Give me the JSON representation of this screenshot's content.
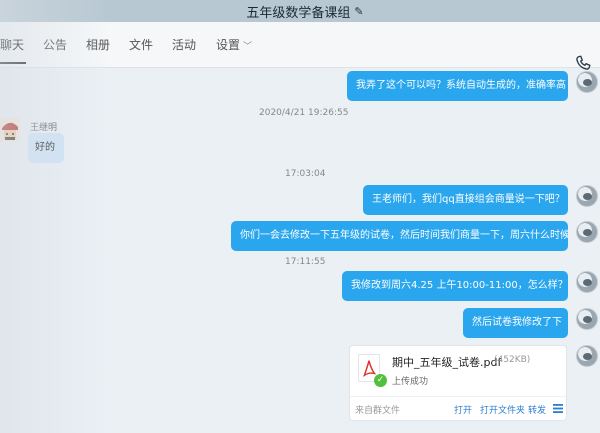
{
  "window": {
    "title": "五年级数学备课组"
  },
  "tabs": [
    {
      "label": "聊天",
      "active": true
    },
    {
      "label": "公告"
    },
    {
      "label": "相册"
    },
    {
      "label": "文件"
    },
    {
      "label": "活动"
    },
    {
      "label": "设置"
    }
  ],
  "messages": {
    "m1": "我弄了这个可以吗？系统自动生成的，准确率高",
    "t1": "2020/4/21 19:26:55",
    "sender": "王继明",
    "m2": "好的",
    "t2": "17:03:04",
    "m3": "王老师们，我们qq直接组会商量说一下吧？",
    "m4": "你们一会去修改一下五年级的试卷，然后时间我们商量一下，周六什么时候？",
    "t3": "17:11:55",
    "m5": "我修改到周六4.25 上午10:00-11:00，怎么样？",
    "m6": "然后试卷我修改了下"
  },
  "file": {
    "name": "期中_五年级_试卷.pdf",
    "size": "(452KB)",
    "status": "上传成功",
    "source": "来自群文件",
    "open": "打开",
    "open_folder": "打开文件夹",
    "forward": "转发"
  },
  "colors": {
    "bubble_self": "#2aa6ee",
    "bubble_other": "#cfe4f7",
    "titlebar": "#b8c8d2"
  }
}
